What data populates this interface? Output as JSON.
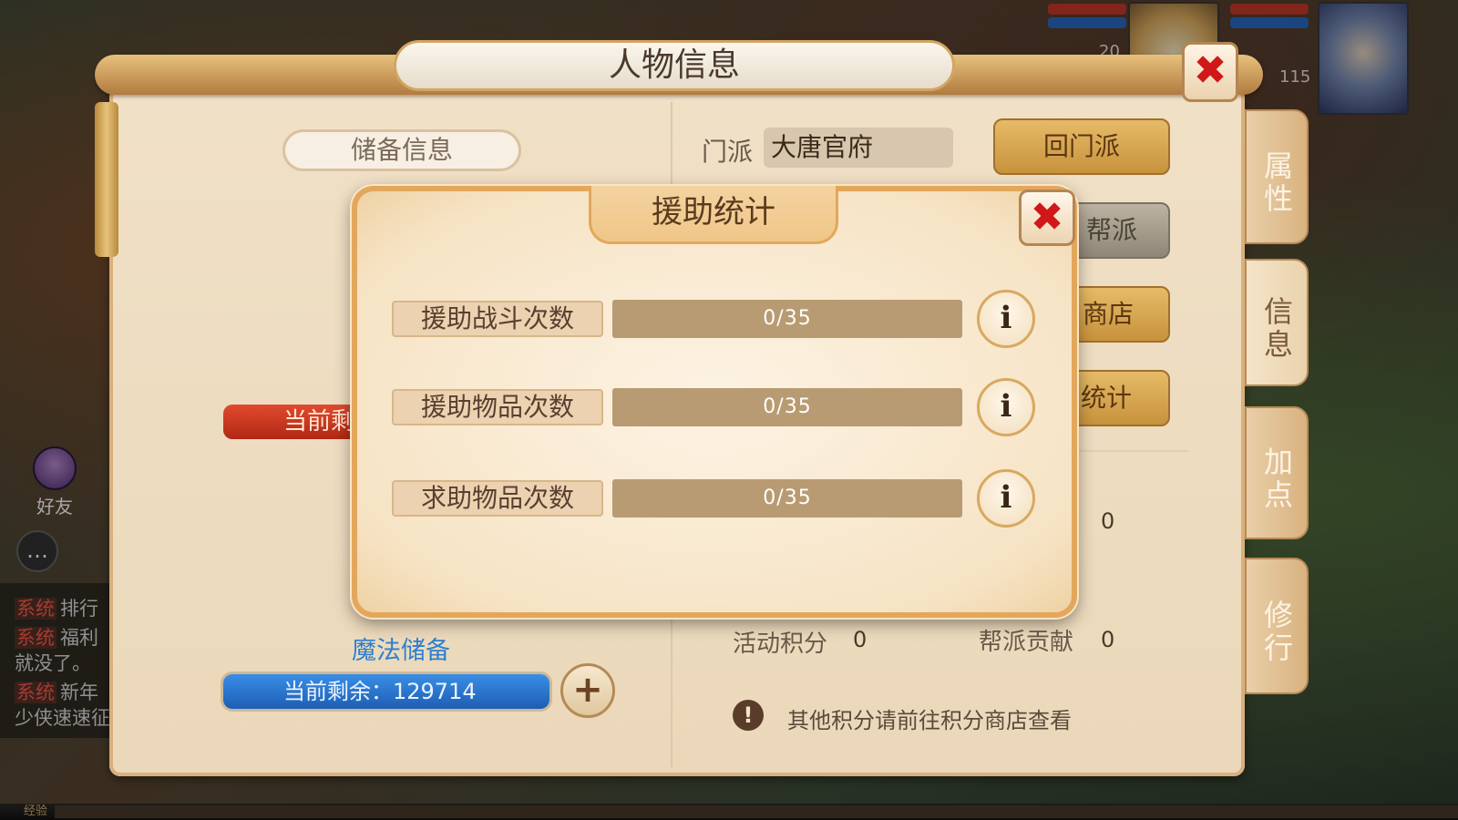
{
  "main": {
    "title": "人物信息",
    "close_icon": "✖",
    "left": {
      "reserve_header": "储备信息",
      "red_bar_text": "当前剩",
      "magic_label": "魔法储备",
      "magic_bar_text": "当前剩余：129714",
      "plus_icon": "+"
    },
    "right": {
      "sect_label": "门派",
      "sect_value": "大唐官府",
      "buttons": [
        "回门派",
        "帮派",
        "商店",
        "统计"
      ],
      "zero_value": "0",
      "activity_label": "活动积分",
      "activity_value": "0",
      "guild_label": "帮派贡献",
      "guild_value": "0",
      "notice_icon": "!",
      "notice_text": "其他积分请前往积分商店查看"
    },
    "side_tabs": [
      "属性",
      "信息",
      "加点",
      "修行"
    ],
    "active_tab": "信息"
  },
  "hud": {
    "level_a": "20",
    "level_b": "115",
    "friend_label": "好友",
    "chat_icon": "…",
    "chat_lines": [
      {
        "tag": "系统",
        "text": "排行"
      },
      {
        "tag": "系统",
        "text": "福利"
      },
      {
        "tag": "",
        "text": "就没了。"
      },
      {
        "tag": "系统",
        "text": "新年"
      },
      {
        "tag": "",
        "text": "少侠速速征"
      }
    ],
    "xp_label": "经验"
  },
  "modal": {
    "title": "援助统计",
    "close_icon": "✖",
    "info_icon": "i",
    "stats": [
      {
        "label": "援助战斗次数",
        "value": "0/35",
        "progress": 0
      },
      {
        "label": "援助物品次数",
        "value": "0/35",
        "progress": 0
      },
      {
        "label": "求助物品次数",
        "value": "0/35",
        "progress": 0
      }
    ]
  },
  "colors": {
    "panel_bg": "#f0e0c6",
    "accent_gold": "#e3a75c",
    "close_red": "#d01818",
    "magic_blue": "#2f7fcf",
    "hp_red": "#c4321c"
  }
}
